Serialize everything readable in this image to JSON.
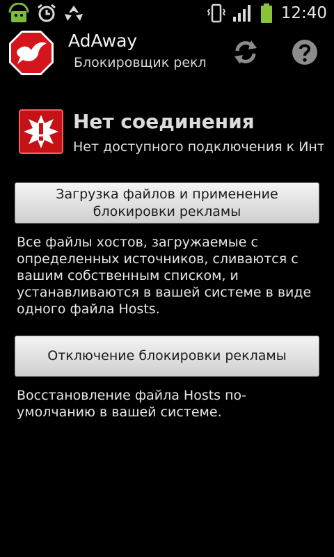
{
  "status_bar": {
    "time": "12:40",
    "icons": [
      "android-debug-icon",
      "alarm-icon",
      "sync-icon",
      "vibrate-icon",
      "signal-icon",
      "battery-icon"
    ]
  },
  "action_bar": {
    "title": "AdAway",
    "subtitle": "Блокировщик рекламы",
    "actions": [
      "refresh-icon",
      "help-icon"
    ]
  },
  "status": {
    "title": "Нет соединения",
    "detail": "Нет доступного подключения к Интернету"
  },
  "enable": {
    "button_label": "Загрузка файлов и применение блокировки рекламы",
    "description": "Все файлы хостов, загружаемые с определенных источников, сливаются с вашим собственным списком, и устанавливаются в вашей системе в виде одного файла Hosts."
  },
  "disable": {
    "button_label": "Отключение блокировки рекламы",
    "description": "Восстановление файла Hosts по-умолчанию в вашей системе."
  },
  "colors": {
    "background": "#000000",
    "button_top": "#f4f4f4",
    "button_bottom": "#cfcfcf",
    "alert_red": "#d4151b",
    "battery_green": "#8ac43a",
    "statusbar_icon": "#d9d9d9"
  }
}
